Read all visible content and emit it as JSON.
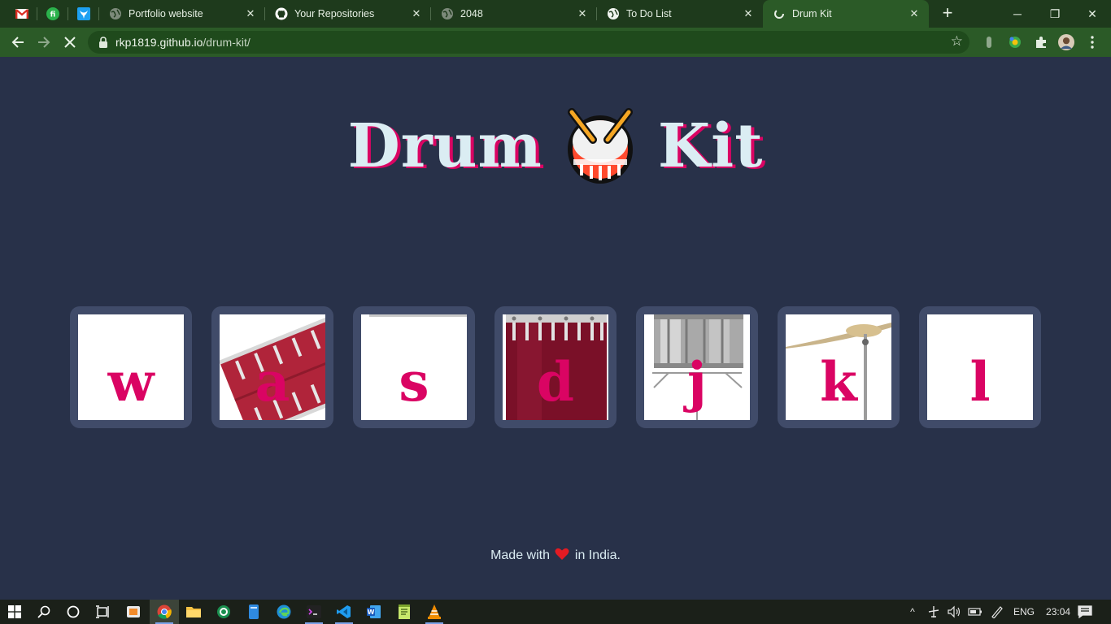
{
  "browser": {
    "pinned_tabs": [
      {
        "name": "gmail-tab-icon"
      },
      {
        "name": "feedly-tab-icon"
      },
      {
        "name": "bird-tab-icon"
      }
    ],
    "tabs": [
      {
        "title": "Portfolio website",
        "icon": "globe-icon",
        "active": false
      },
      {
        "title": "Your Repositories",
        "icon": "github-icon",
        "active": false
      },
      {
        "title": "2048",
        "icon": "globe-icon",
        "active": false
      },
      {
        "title": "To Do List",
        "icon": "globe-white-icon",
        "active": false
      },
      {
        "title": "Drum Kit",
        "icon": "loading-icon",
        "active": true
      }
    ],
    "close_glyph": "✕",
    "new_tab_glyph": "+",
    "url_host": "rkp1819.github.io",
    "url_path": "/drum-kit/",
    "window_controls": {
      "minimize": "─",
      "restore": "❐",
      "close": "✕"
    }
  },
  "page": {
    "title_left": "Drum",
    "title_right": "Kit",
    "keys": [
      "w",
      "a",
      "s",
      "d",
      "j",
      "k",
      "l"
    ],
    "footer_before": "Made with",
    "footer_after": "in India.",
    "colors": {
      "background": "#283149",
      "title": "#dbedf3",
      "accent": "#da0463",
      "key_frame": "#404b69"
    }
  },
  "taskbar": {
    "language": "ENG",
    "time": "23:04"
  }
}
